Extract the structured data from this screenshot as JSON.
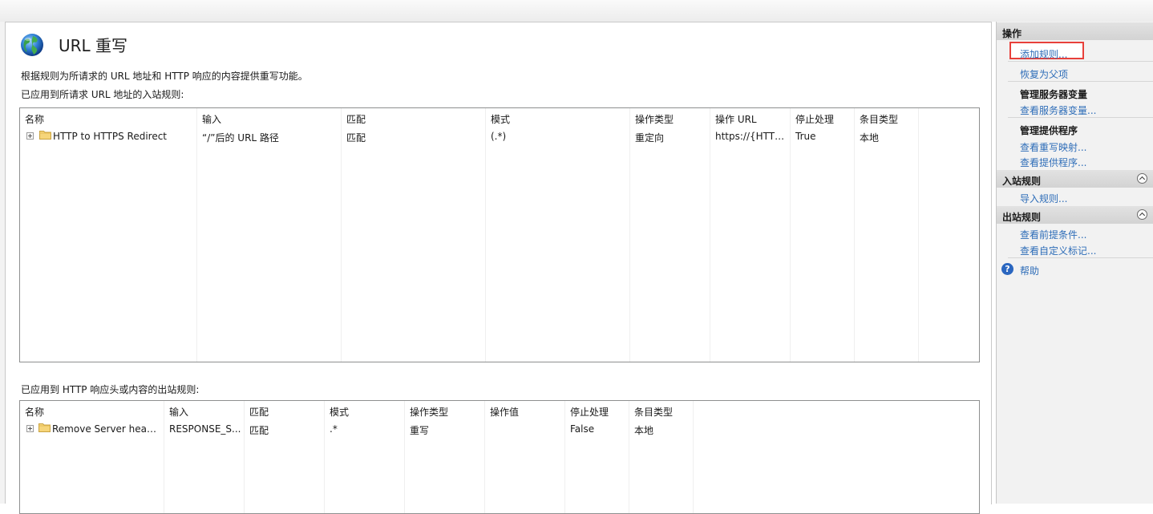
{
  "page": {
    "title": "URL 重写",
    "description": "根据规则为所请求的 URL 地址和 HTTP 响应的内容提供重写功能。"
  },
  "inbound": {
    "caption": "已应用到所请求 URL 地址的入站规则:",
    "columns": [
      "名称",
      "输入",
      "匹配",
      "模式",
      "操作类型",
      "操作 URL",
      "停止处理",
      "条目类型"
    ],
    "rows": [
      {
        "name": "HTTP to HTTPS Redirect",
        "input": "“/”后的 URL 路径",
        "match": "匹配",
        "pattern": "(.*)",
        "action_type": "重定向",
        "action_url": "https://{HTTP...",
        "stop": "True",
        "entry_type": "本地"
      }
    ]
  },
  "outbound": {
    "caption": "已应用到 HTTP 响应头或内容的出站规则:",
    "columns": [
      "名称",
      "输入",
      "匹配",
      "模式",
      "操作类型",
      "操作值",
      "停止处理",
      "条目类型"
    ],
    "rows": [
      {
        "name": "Remove Server header",
        "input": "RESPONSE_S...",
        "match": "匹配",
        "pattern": ".*",
        "action_type": "重写",
        "action_value": "",
        "stop": "False",
        "entry_type": "本地"
      }
    ]
  },
  "actions": {
    "header": "操作",
    "add_rule": "添加规则...",
    "revert_parent": "恢复为父项",
    "server_vars_group": "管理服务器变量",
    "view_server_vars": "查看服务器变量...",
    "providers_group": "管理提供程序",
    "view_rewrite_maps": "查看重写映射...",
    "view_providers": "查看提供程序...",
    "inbound_header": "入站规则",
    "import_rules": "导入规则...",
    "outbound_header": "出站规则",
    "view_preconditions": "查看前提条件...",
    "view_custom_tags": "查看自定义标记...",
    "help": "帮助"
  },
  "colors": {
    "link": "#2e6db8",
    "highlight_border": "#e8403a"
  },
  "icons": {
    "page": "globe-icon",
    "row": "folder-icon",
    "expand": "expand-plus-icon",
    "collapse": "collapse-chevron-icon",
    "help": "help-icon"
  }
}
